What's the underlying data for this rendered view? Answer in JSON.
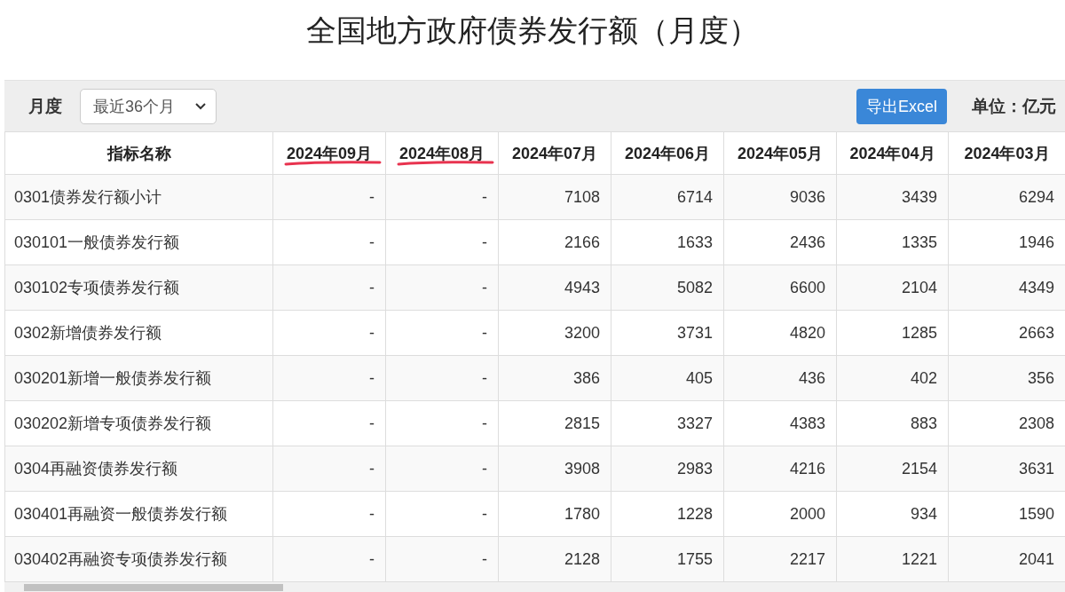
{
  "title": "全国地方政府债券发行额（月度）",
  "toolbar": {
    "period_label": "月度",
    "period_select": "最近36个月",
    "export_button": "导出Excel",
    "unit": "单位：亿元"
  },
  "table": {
    "columns": [
      {
        "label": "指标名称",
        "marked": false
      },
      {
        "label": "2024年09月",
        "marked": true
      },
      {
        "label": "2024年08月",
        "marked": true
      },
      {
        "label": "2024年07月",
        "marked": false
      },
      {
        "label": "2024年06月",
        "marked": false
      },
      {
        "label": "2024年05月",
        "marked": false
      },
      {
        "label": "2024年04月",
        "marked": false
      },
      {
        "label": "2024年03月",
        "marked": false
      }
    ],
    "rows": [
      [
        "0301债券发行额小计",
        "-",
        "-",
        "7108",
        "6714",
        "9036",
        "3439",
        "6294"
      ],
      [
        "030101一般债券发行额",
        "-",
        "-",
        "2166",
        "1633",
        "2436",
        "1335",
        "1946"
      ],
      [
        "030102专项债券发行额",
        "-",
        "-",
        "4943",
        "5082",
        "6600",
        "2104",
        "4349"
      ],
      [
        "0302新增债券发行额",
        "-",
        "-",
        "3200",
        "3731",
        "4820",
        "1285",
        "2663"
      ],
      [
        "030201新增一般债券发行额",
        "-",
        "-",
        "386",
        "405",
        "436",
        "402",
        "356"
      ],
      [
        "030202新增专项债券发行额",
        "-",
        "-",
        "2815",
        "3327",
        "4383",
        "883",
        "2308"
      ],
      [
        "0304再融资债券发行额",
        "-",
        "-",
        "3908",
        "2983",
        "4216",
        "2154",
        "3631"
      ],
      [
        "030401再融资一般债券发行额",
        "-",
        "-",
        "1780",
        "1228",
        "2000",
        "934",
        "1590"
      ],
      [
        "030402再融资专项债券发行额",
        "-",
        "-",
        "2128",
        "1755",
        "2217",
        "1221",
        "2041"
      ]
    ]
  }
}
